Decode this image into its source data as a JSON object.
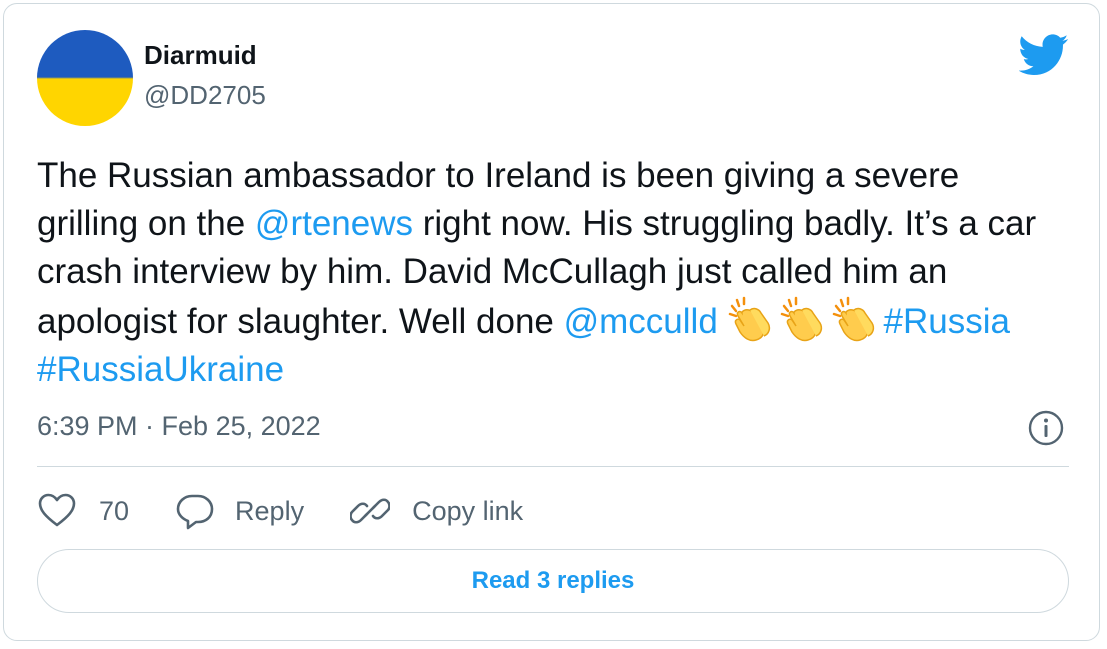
{
  "author": {
    "name": "Diarmuid",
    "handle": "@DD2705",
    "avatar_colors": [
      "#1e5bbf",
      "#ffd500"
    ]
  },
  "tweet": {
    "text_1": "The Russian ambassador to Ireland is been giving a severe grilling on the ",
    "mention_1": "@rtenews",
    "text_2": " right now. His struggling badly.  It’s a car crash interview by him. David McCullagh just called him an apologist for slaughter. Well done ",
    "mention_2": "@mcculld",
    "emoji_name": "clapping-hands-icon",
    "hashtag_1": "#Russia",
    "hashtag_2": "#RussiaUkraine"
  },
  "meta": {
    "timestamp": "6:39 PM · Feb 25, 2022"
  },
  "actions": {
    "like_count": "70",
    "reply_label": "Reply",
    "copy_link_label": "Copy link"
  },
  "replies_button": {
    "label": "Read 3 replies"
  },
  "colors": {
    "link": "#1d9bf0",
    "text": "#0f1419",
    "muted": "#536471",
    "border": "#cfd9de"
  }
}
